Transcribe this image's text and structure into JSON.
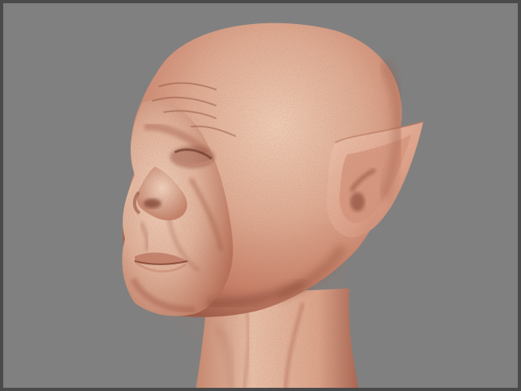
{
  "scene": {
    "subject_icon": "bald-pointed-ear-head-3d-render-icon",
    "colors": {
      "background": "#808080",
      "frame": "#4a4a4a",
      "skin_light": "#e9c0a8",
      "skin_mid": "#d89a80",
      "skin_shadow": "#a8624c",
      "skin_dark": "#6e3a2c"
    }
  }
}
